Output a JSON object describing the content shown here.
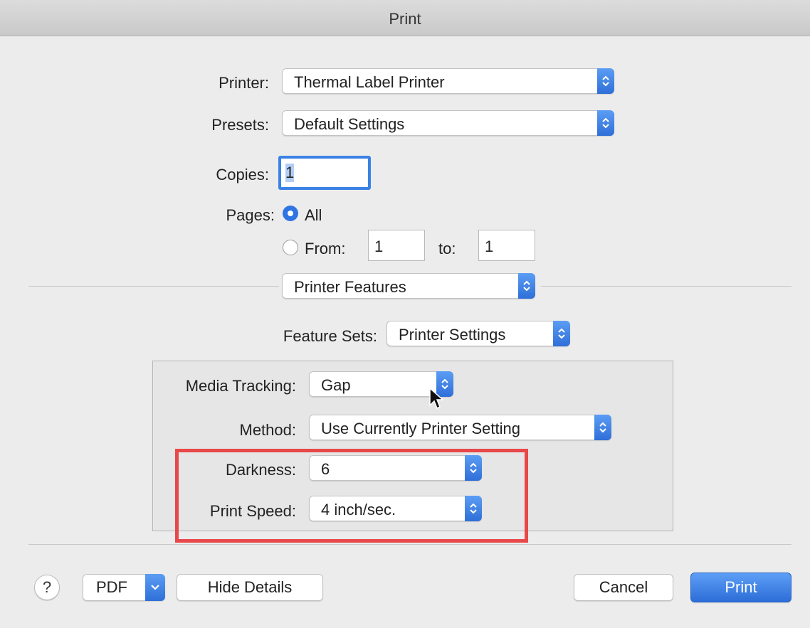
{
  "window": {
    "title": "Print"
  },
  "printer": {
    "label": "Printer:",
    "value": "Thermal Label Printer"
  },
  "presets": {
    "label": "Presets:",
    "value": "Default Settings"
  },
  "copies": {
    "label": "Copies:",
    "value": "1"
  },
  "pages": {
    "label": "Pages:",
    "all_label": "All",
    "from_label": "From:",
    "from_value": "1",
    "to_label": "to:",
    "to_value": "1",
    "selected": "All"
  },
  "panel_select": {
    "value": "Printer Features"
  },
  "feature_sets": {
    "label": "Feature Sets:",
    "value": "Printer Settings"
  },
  "media_tracking": {
    "label": "Media Tracking:",
    "value": "Gap"
  },
  "method": {
    "label": "Method:",
    "value": "Use Currently Printer Setting"
  },
  "darkness": {
    "label": "Darkness:",
    "value": "6"
  },
  "print_speed": {
    "label": "Print Speed:",
    "value": "4 inch/sec."
  },
  "footer": {
    "help_label": "?",
    "pdf_label": "PDF",
    "hide_details_label": "Hide Details",
    "cancel_label": "Cancel",
    "print_label": "Print"
  },
  "colors": {
    "accent": "#2f6fd8",
    "highlight_box": "#e8484a"
  }
}
